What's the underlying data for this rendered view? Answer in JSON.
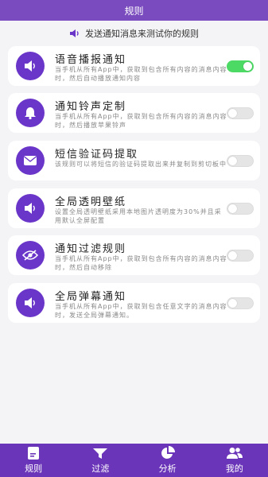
{
  "header": {
    "title": "规则"
  },
  "subtitle": {
    "text": "发送通知消息来测试你的规则",
    "icon": "speaker-icon"
  },
  "cards": [
    {
      "icon": "speaker-icon",
      "title": "语音播报通知",
      "desc": "当手机从所有App中，获取到包含所有内容的消息内容时，然后自动播放通知内容",
      "enabled": true
    },
    {
      "icon": "bell-icon",
      "title": "通知铃声定制",
      "desc": "当手机从所有App中，获取到包含所有内容的消息内容时，然后播放苹果铃声",
      "enabled": false
    },
    {
      "icon": "mail-icon",
      "title": "短信验证码提取",
      "desc": "该规则可以将短信的验证码提取出来并复制到剪切板中",
      "enabled": false
    },
    {
      "icon": "speaker-icon",
      "title": "全局透明壁纸",
      "desc": "设置全局透明壁纸采用本地图片透明度为30%并且采用默认全屏配置",
      "enabled": false
    },
    {
      "icon": "eye-off-icon",
      "title": "通知过滤规则",
      "desc": "当手机从所有App中，获取到包含所有内容的消息内容时，然后自动移除",
      "enabled": false
    },
    {
      "icon": "speaker-icon",
      "title": "全局弹幕通知",
      "desc": "当手机从所有App中，获取到包含任意文字的消息内容时，发送全局弹幕通知。",
      "enabled": false
    }
  ],
  "tabs": [
    {
      "label": "规则",
      "icon": "document-icon"
    },
    {
      "label": "过滤",
      "icon": "filter-icon"
    },
    {
      "label": "分析",
      "icon": "pie-chart-icon"
    },
    {
      "label": "我的",
      "icon": "users-icon"
    }
  ],
  "colors": {
    "brand": "#7a4bbf",
    "icon_bg": "#6a35c9",
    "toggle_on": "#4cd964"
  }
}
